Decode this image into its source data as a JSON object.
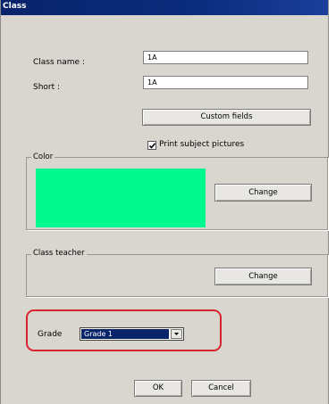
{
  "window": {
    "title": "Class"
  },
  "form": {
    "class_name_label": "Class name :",
    "class_name_value": "1A",
    "short_label": "Short :",
    "short_value": "1A",
    "custom_fields_label": "Custom fields",
    "print_pictures_label": "Print subject pictures",
    "print_pictures_checked": true
  },
  "color_group": {
    "label": "Color",
    "swatch_color": "#00f98e",
    "change_label": "Change"
  },
  "teacher_group": {
    "label": "Class teacher",
    "change_label": "Change"
  },
  "grade": {
    "label": "Grade",
    "selected": "Grade 1"
  },
  "highlight_color": "#d9232e",
  "footer": {
    "ok_label": "OK",
    "cancel_label": "Cancel"
  }
}
